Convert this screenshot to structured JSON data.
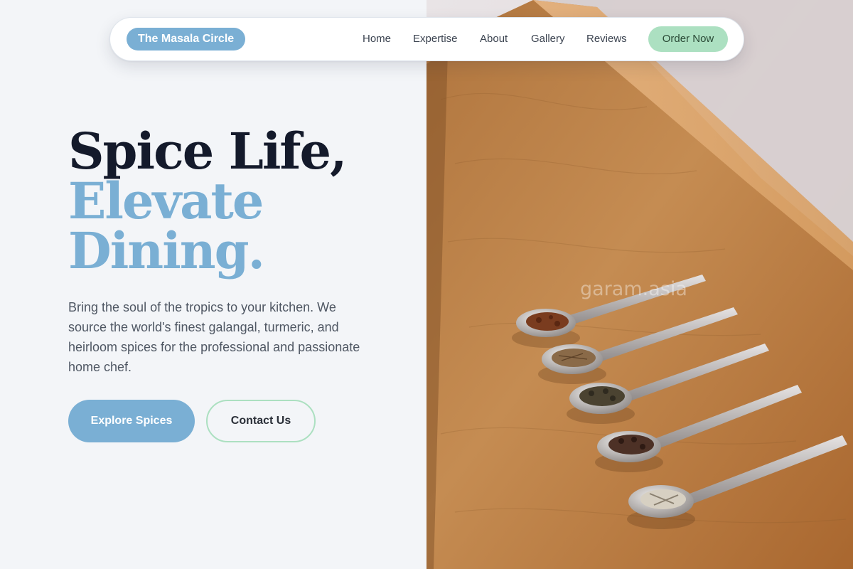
{
  "nav": {
    "brand": "The Masala Circle",
    "links": [
      "Home",
      "Expertise",
      "About",
      "Gallery",
      "Reviews"
    ],
    "cta": "Order Now"
  },
  "hero": {
    "headline_line1": "Spice Life,",
    "headline_line2": "Elevate",
    "headline_line3": "Dining.",
    "description": "Bring the soul of the tropics to your kitchen. We source the world's finest galangal, turmeric, and heirloom spices for the professional and passionate home chef.",
    "primary_button": "Explore Spices",
    "secondary_button": "Contact Us"
  },
  "image": {
    "watermark": "garam.asia",
    "subject": "five-spice-spoons-on-wooden-table"
  },
  "colors": {
    "accent_blue": "#7aafd4",
    "accent_green": "#ace0c1",
    "heading_dark": "#141a2b",
    "background": "#f3f5f8"
  }
}
